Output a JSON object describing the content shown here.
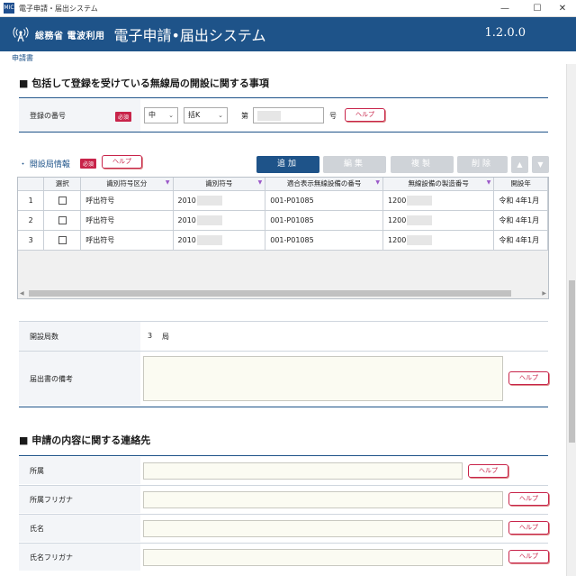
{
  "window": {
    "title": "電子申請・届出システム",
    "icon_text": "MIC"
  },
  "header": {
    "ministry": "総務省 電波利用",
    "system_name": "電子申請•届出システム",
    "version": "1.2.0.0"
  },
  "breadcrumb": "申請書",
  "section1": {
    "title": "■ 包括して登録を受けている無線局の開設に関する事項",
    "reg_label": "登録の番号",
    "required": "必須",
    "select1": "中",
    "select2": "括K",
    "dai": "第",
    "go": "号",
    "help": "ヘルプ"
  },
  "stations": {
    "label": "・ 開設局情報",
    "required": "必須",
    "help": "ヘルプ",
    "buttons": {
      "add": "追加",
      "edit": "編集",
      "copy": "複製",
      "delete": "削除",
      "up": "▲",
      "down": "▼"
    },
    "columns": [
      "",
      "選択",
      "識別符号区分",
      "識別符号",
      "適合表示無線設備の番号",
      "無線設備の製造番号",
      "開設年"
    ],
    "rows": [
      {
        "no": "1",
        "kubun": "呼出符号",
        "code": "2010",
        "cert": "001-P01085",
        "serial": "1200",
        "date": "令和 4年1月"
      },
      {
        "no": "2",
        "kubun": "呼出符号",
        "code": "2010",
        "cert": "001-P01085",
        "serial": "1200",
        "date": "令和 4年1月"
      },
      {
        "no": "3",
        "kubun": "呼出符号",
        "code": "2010",
        "cert": "001-P01085",
        "serial": "1200",
        "date": "令和 4年1月"
      }
    ],
    "count_label": "開設局数",
    "count_value": "3",
    "count_unit": "局",
    "remarks_label": "届出書の備考",
    "remarks_help": "ヘルプ"
  },
  "contact": {
    "title": "■ 申請の内容に関する連絡先",
    "fields": [
      {
        "label": "所属",
        "help": "ヘルプ"
      },
      {
        "label": "所属フリガナ",
        "help": "ヘルプ"
      },
      {
        "label": "氏名",
        "help": "ヘルプ"
      },
      {
        "label": "氏名フリガナ",
        "help": "ヘルプ"
      }
    ]
  },
  "colors": {
    "header": "#1e5389",
    "accent": "#c8244a",
    "field_bg": "#fbfbf2"
  },
  "icons": [
    "antenna-icon",
    "minimize-icon",
    "maximize-icon",
    "close-icon",
    "chevron-down-icon",
    "sort-arrow-icon"
  ]
}
